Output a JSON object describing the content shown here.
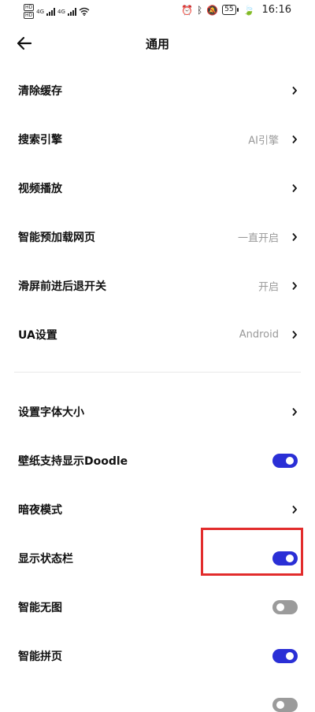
{
  "status_bar": {
    "left": {
      "hd1": "HD",
      "hd2": "HD",
      "net1": "4G",
      "net2": "4G"
    },
    "battery": "55",
    "time": "16:16"
  },
  "header": {
    "title": "通用"
  },
  "items": [
    {
      "label": "清除缓存",
      "value": "",
      "control": "chevron"
    },
    {
      "label": "搜索引擎",
      "value": "AI引擎",
      "control": "chevron"
    },
    {
      "label": "视频播放",
      "value": "",
      "control": "chevron"
    },
    {
      "label": "智能预加载网页",
      "value": "一直开启",
      "control": "chevron"
    },
    {
      "label": "滑屏前进后退开关",
      "value": "开启",
      "control": "chevron"
    },
    {
      "label": "UA设置",
      "value": "Android",
      "control": "chevron"
    },
    {
      "label": "设置字体大小",
      "value": "",
      "control": "chevron"
    },
    {
      "label": "壁纸支持显示Doodle",
      "control": "toggle",
      "checked": true
    },
    {
      "label": "暗夜模式",
      "value": "",
      "control": "chevron"
    },
    {
      "label": "显示状态栏",
      "control": "toggle",
      "checked": true
    },
    {
      "label": "智能无图",
      "control": "toggle",
      "checked": false
    },
    {
      "label": "智能拼页",
      "control": "toggle",
      "checked": true
    }
  ],
  "colors": {
    "accent": "#2a2fd6",
    "toggle_off": "#9b9b9b",
    "highlight": "#e22c2c"
  },
  "icons": [
    "back-arrow-icon",
    "chevron-right-icon",
    "wifi-icon",
    "alarm-icon",
    "bluetooth-icon",
    "mute-icon",
    "leaf-icon",
    "battery-icon"
  ]
}
